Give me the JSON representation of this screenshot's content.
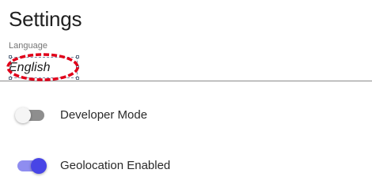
{
  "page": {
    "title": "Settings"
  },
  "language": {
    "label": "Language",
    "value": "English"
  },
  "toggles": [
    {
      "label": "Developer Mode",
      "state": "off"
    },
    {
      "label": "Geolocation Enabled",
      "state": "on"
    }
  ],
  "colors": {
    "accent": "#4845e6",
    "accent_track": "#8f8df0",
    "annotation": "#e0001a"
  }
}
